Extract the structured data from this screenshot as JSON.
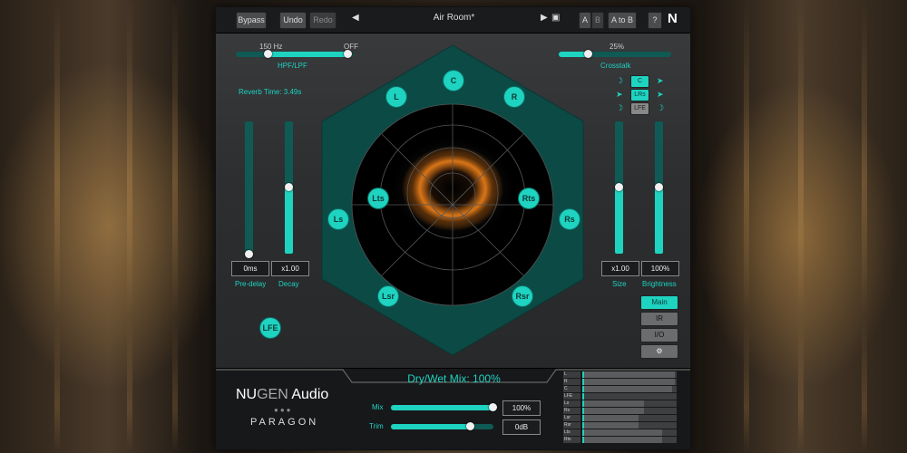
{
  "toolbar": {
    "bypass": "Bypass",
    "undo": "Undo",
    "redo": "Redo",
    "prev": "◀",
    "preset": "Air Room*",
    "next": "▶",
    "save": "▣",
    "a": "A",
    "b": "B",
    "atob": "A to B",
    "help": "?",
    "logo": "N"
  },
  "hpf": {
    "left_value": "150 Hz",
    "right_value": "OFF",
    "label": "HPF/LPF",
    "fill_from": 0.0,
    "low": 0.28,
    "high": 0.95
  },
  "crosstalk": {
    "value": "25%",
    "label": "Crosstalk",
    "level": 0.25
  },
  "reverb_time": "Reverb Time: 3.49s",
  "predelay": {
    "value": "0ms",
    "label": "Pre-delay",
    "level": 0.0
  },
  "decay": {
    "value": "x1.00",
    "label": "Decay",
    "level": 0.5
  },
  "size": {
    "value": "x1.00",
    "label": "Size",
    "level": 0.5
  },
  "brightness": {
    "value": "100%",
    "label": "Brightness",
    "level": 0.5
  },
  "speakers": [
    "C",
    "L",
    "R",
    "Lts",
    "Rts",
    "Ls",
    "Rs",
    "Lsr",
    "Rsr"
  ],
  "lfe": "LFE",
  "channel_buttons": [
    "C",
    "LRs",
    "LFE"
  ],
  "right_menu": {
    "main": "Main",
    "ir": "IR",
    "io": "I/O",
    "settings": "⚙"
  },
  "drywet": "Dry/Wet Mix: 100%",
  "brand": {
    "nu": "NU",
    "gen": "GEN",
    "audio": " Audio",
    "product": "PARAGON"
  },
  "mix": {
    "label": "Mix",
    "value": "100%",
    "level": 1.0
  },
  "trim": {
    "label": "Trim",
    "value": "0dB",
    "level": 0.78
  },
  "meters": [
    {
      "label": "L",
      "level": 0.98
    },
    {
      "label": "R",
      "level": 0.98
    },
    {
      "label": "C",
      "level": 0.95
    },
    {
      "label": "LFE",
      "level": 0.0
    },
    {
      "label": "Ls",
      "level": 0.65
    },
    {
      "label": "Rs",
      "level": 0.65
    },
    {
      "label": "Lsr",
      "level": 0.6
    },
    {
      "label": "Rsr",
      "level": 0.6
    },
    {
      "label": "Lts",
      "level": 0.85
    },
    {
      "label": "Rts",
      "level": 0.85
    }
  ],
  "colors": {
    "accent": "#1ed3c0",
    "accent_dark": "#0f5a54",
    "hex": "#0c4a45",
    "reverb": "#ff8a1c"
  }
}
